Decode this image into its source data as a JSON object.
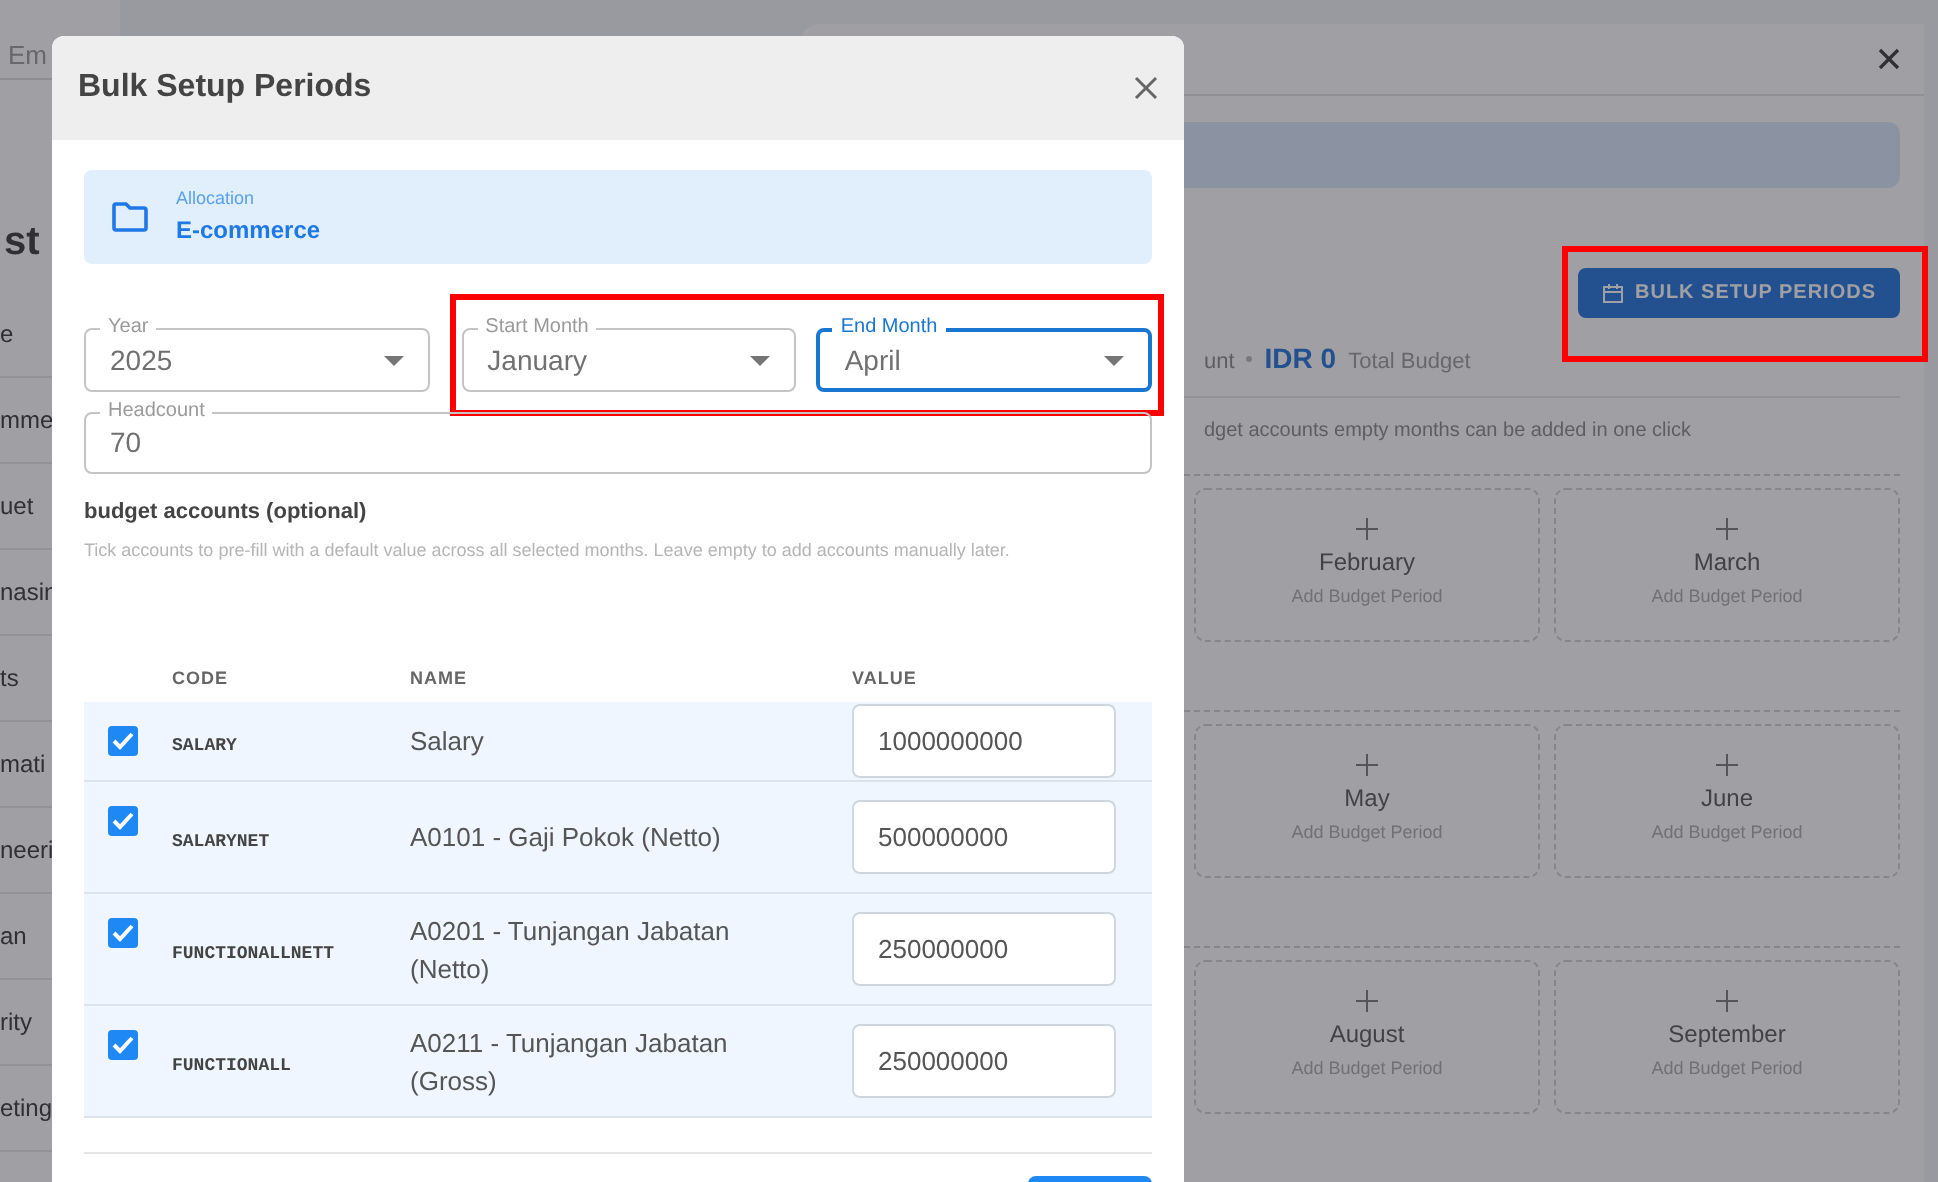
{
  "background": {
    "search_fragment": "Em",
    "heading_fragment": "st",
    "sidebar_fragments": [
      "e",
      "mme",
      "uet",
      "nasin",
      "ts",
      "mati",
      "neeri",
      "an",
      "rity",
      "eting"
    ]
  },
  "drawer": {
    "bulk_button": "BULK SETUP PERIODS",
    "summary": {
      "prefix": "unt",
      "amount": "IDR 0",
      "label": "Total Budget"
    },
    "hint": "dget accounts empty months can be added in one click",
    "month_rows": [
      {
        "months": [
          {
            "name": "February",
            "action": "Add Budget Period"
          },
          {
            "name": "March",
            "action": "Add Budget Period"
          }
        ]
      },
      {
        "months": [
          {
            "name": "May",
            "action": "Add Budget Period"
          },
          {
            "name": "June",
            "action": "Add Budget Period"
          }
        ]
      },
      {
        "months": [
          {
            "name": "August",
            "action": "Add Budget Period"
          },
          {
            "name": "September",
            "action": "Add Budget Period"
          }
        ]
      }
    ]
  },
  "modal": {
    "title": "Bulk Setup Periods",
    "allocation": {
      "label": "Allocation",
      "value": "E-commerce"
    },
    "field_groups": [
      {
        "highlighted": false,
        "fields": [
          {
            "kind": "select",
            "label": "Year",
            "value": "2025",
            "focused": false
          }
        ]
      },
      {
        "highlighted": true,
        "fields": [
          {
            "kind": "select",
            "label": "Start Month",
            "value": "January",
            "focused": false
          },
          {
            "kind": "select",
            "label": "End Month",
            "value": "April",
            "focused": true
          }
        ]
      }
    ],
    "headcount": {
      "label": "Headcount",
      "value": "70"
    },
    "section_title": "budget accounts (optional)",
    "section_hint": "Tick accounts to pre-fill with a default value across all selected months. Leave empty to add accounts manually later.",
    "columns": [
      "CODE",
      "NAME",
      "VALUE"
    ],
    "rows": [
      {
        "checked": true,
        "code": "SALARY",
        "name": "Salary",
        "value": "1000000000"
      },
      {
        "checked": true,
        "code": "SALARYNET",
        "name": "A0101 - Gaji Pokok (Netto)",
        "value": "500000000"
      },
      {
        "checked": true,
        "code": "FUNCTIONALLNETT",
        "name": "A0201 - Tunjangan Jabatan (Netto)",
        "value": "250000000"
      },
      {
        "checked": true,
        "code": "FUNCTIONALL",
        "name": "A0211 - Tunjangan Jabatan (Gross)",
        "value": "250000000"
      }
    ]
  }
}
